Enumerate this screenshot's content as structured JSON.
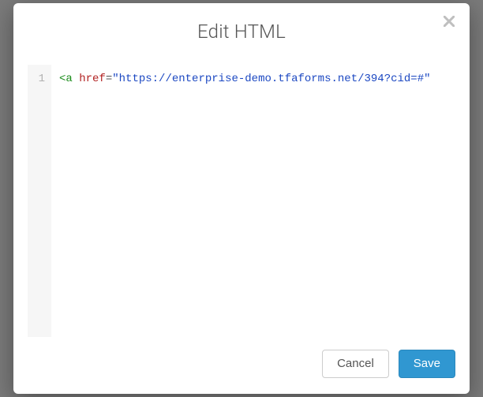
{
  "modal": {
    "title": "Edit HTML",
    "close_label": "Close"
  },
  "editor": {
    "lines": [
      {
        "number": "1",
        "tokens": {
          "open_bracket": "<",
          "tag": "a",
          "space": " ",
          "attr": "href",
          "equals": "=",
          "quote_open": "\"",
          "string": "https://enterprise-demo.tfaforms.net/394?cid=#",
          "quote_close": "\""
        }
      }
    ]
  },
  "footer": {
    "cancel_label": "Cancel",
    "save_label": "Save"
  }
}
